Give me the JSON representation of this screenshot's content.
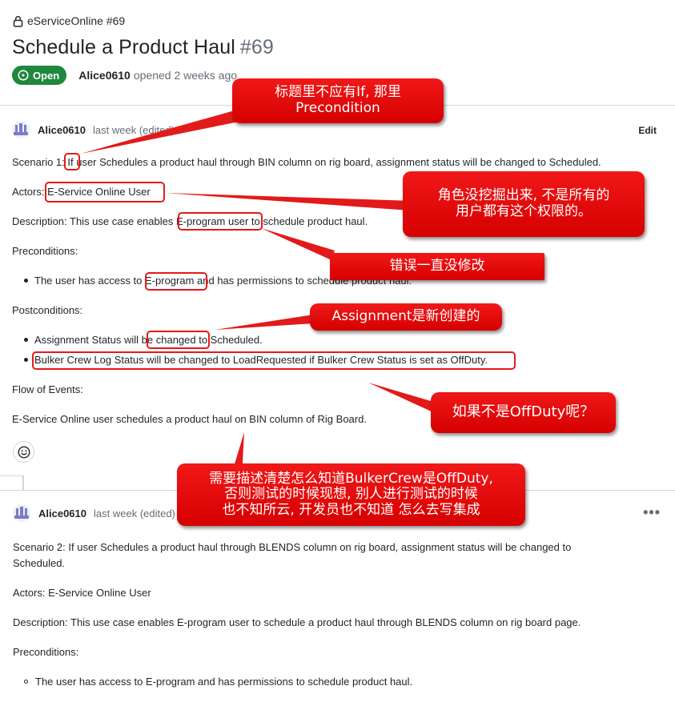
{
  "repo": {
    "name": "eServiceOnline #69"
  },
  "issue": {
    "title": "Schedule a Product Haul",
    "number": "#69",
    "state": "Open",
    "author": "Alice0610",
    "opened_text": "opened 2 weeks ago"
  },
  "comment1": {
    "user": "Alice0610",
    "time": "last week (edited)",
    "edit_label": "Edit",
    "scenario": "Scenario 1: If user Schedules a product haul through BIN column on rig board, assignment status will be changed to Scheduled.",
    "actors": "Actors: E-Service Online User",
    "description": "Description: This use case enables E-program user to schedule product haul.",
    "preconditions_label": "Preconditions:",
    "preconditions": [
      "The user has access to E-program and has permissions to schedule product haul."
    ],
    "postconditions_label": "Postconditions:",
    "postconditions": [
      "Assignment Status will be changed to Scheduled.",
      "Bulker Crew Log Status will be changed to LoadRequested if Bulker Crew Status is set as OffDuty."
    ],
    "flow_label": "Flow of Events:",
    "flow": "E-Service Online user schedules a product haul on BIN column of Rig Board."
  },
  "comment2": {
    "user": "Alice0610",
    "time": "last week (edited)",
    "menu": "•••",
    "scenario_line1": "Scenario 2: If user Schedules a product haul through BLENDS column on rig board, assignment status will be changed to",
    "scenario_line2": "Scheduled.",
    "actors": "Actors: E-Service Online User",
    "description": "Description: This use case enables E-program user to schedule a product haul through BLENDS column on rig board page.",
    "preconditions_label": "Preconditions:",
    "preconditions": [
      "The user has access to E-program and has permissions to schedule product haul."
    ]
  },
  "annotations": {
    "a1_line1": "标题里不应有If, 那里",
    "a1_line2": "Precondition",
    "a2_line1": "角色没挖掘出来, 不是所有的",
    "a2_line2": "用户都有这个权限的。",
    "a3": "错误一直没修改",
    "a4": "Assignment是新创建的",
    "a5": "如果不是OffDuty呢？",
    "a6_line1": "需要描述清楚怎么知道BulkerCrew是OffDuty,",
    "a6_line2": "否则测试的时候现想, 别人进行测试的时候",
    "a6_line3": "也不知所云, 开发员也不知道 怎么去写集成"
  },
  "colors": {
    "open_green": "#1f883d",
    "annotation_red": "#e31a1a",
    "muted": "#656d76"
  },
  "icons": [
    "lock-icon",
    "issue-open-icon",
    "smiley-icon",
    "kebab-icon"
  ]
}
